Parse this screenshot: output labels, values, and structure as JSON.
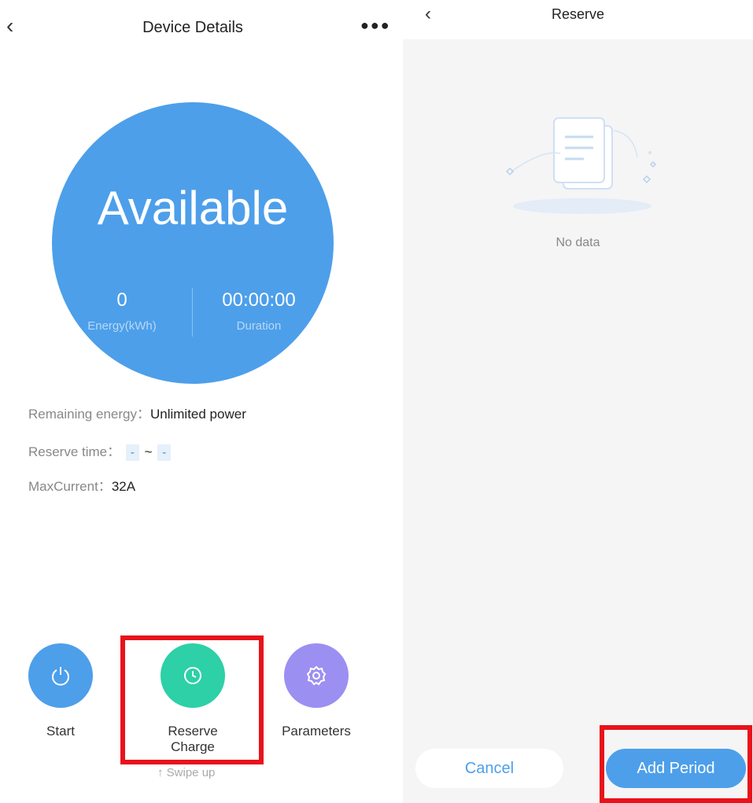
{
  "device": {
    "title": "Device Details",
    "back_icon": "chevron-left-icon",
    "more_icon": "more-horizontal-icon",
    "status": "Available",
    "energy_value": "0",
    "energy_label": "Energy(kWh)",
    "duration_value": "00:00:00",
    "duration_label": "Duration",
    "remaining_label": "Remaining energy：",
    "remaining_value": "Unlimited power",
    "reserve_label": "Reserve time：",
    "reserve_start": "-",
    "reserve_sep": "~",
    "reserve_end": "-",
    "maxcurrent_label": "MaxCurrent：",
    "maxcurrent_value": "32A",
    "actions": [
      {
        "label": "Start",
        "icon": "power-icon",
        "color": "#4d9fea"
      },
      {
        "label": "Reserve Charge",
        "icon": "clock-icon",
        "color": "#2dd0a7"
      },
      {
        "label": "Parameters",
        "icon": "gear-icon",
        "color": "#9b8ff2"
      }
    ],
    "swipe_hint": "↑ Swipe up"
  },
  "reserve": {
    "title": "Reserve",
    "back_icon": "chevron-left-icon",
    "empty_text": "No data",
    "cancel_label": "Cancel",
    "add_label": "Add Period"
  },
  "colors": {
    "primary": "#4d9fea",
    "highlight": "#e8121b"
  }
}
